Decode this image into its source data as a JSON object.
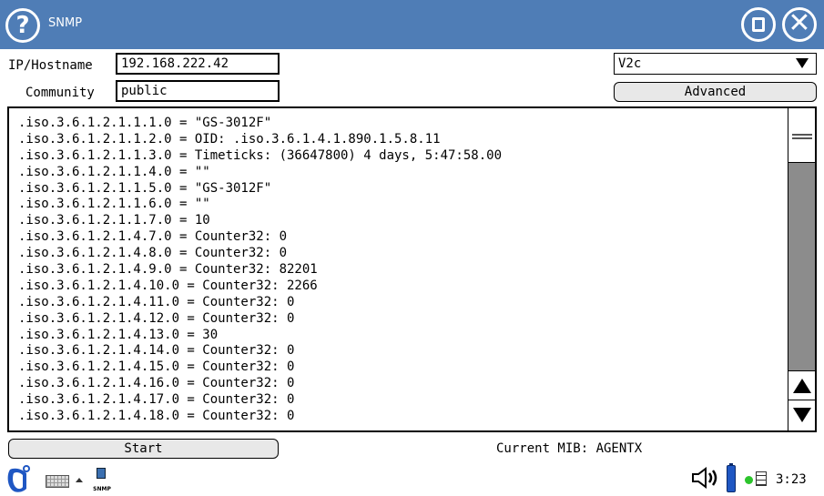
{
  "window": {
    "title": "SNMP",
    "help_glyph": "?",
    "close_glyph": "✕",
    "titlebar_color": "#4f7db6"
  },
  "form": {
    "ip_label": "IP/Hostname",
    "ip_value": "192.168.222.42",
    "community_label": "Community",
    "community_value": "public",
    "version_selected": "V2c",
    "advanced_label": "Advanced"
  },
  "output": {
    "lines": [
      ".iso.3.6.1.2.1.1.1.0 = \"GS-3012F\"",
      ".iso.3.6.1.2.1.1.2.0 = OID: .iso.3.6.1.4.1.890.1.5.8.11",
      ".iso.3.6.1.2.1.1.3.0 = Timeticks: (36647800) 4 days, 5:47:58.00",
      ".iso.3.6.1.2.1.1.4.0 = \"\"",
      ".iso.3.6.1.2.1.1.5.0 = \"GS-3012F\"",
      ".iso.3.6.1.2.1.1.6.0 = \"\"",
      ".iso.3.6.1.2.1.1.7.0 = 10",
      ".iso.3.6.1.2.1.4.7.0 = Counter32: 0",
      ".iso.3.6.1.2.1.4.8.0 = Counter32: 0",
      ".iso.3.6.1.2.1.4.9.0 = Counter32: 82201",
      ".iso.3.6.1.2.1.4.10.0 = Counter32: 2266",
      ".iso.3.6.1.2.1.4.11.0 = Counter32: 0",
      ".iso.3.6.1.2.1.4.12.0 = Counter32: 0",
      ".iso.3.6.1.2.1.4.13.0 = 30",
      ".iso.3.6.1.2.1.4.14.0 = Counter32: 0",
      ".iso.3.6.1.2.1.4.15.0 = Counter32: 0",
      ".iso.3.6.1.2.1.4.16.0 = Counter32: 0",
      ".iso.3.6.1.2.1.4.17.0 = Counter32: 0",
      ".iso.3.6.1.2.1.4.18.0 = Counter32: 0"
    ]
  },
  "controls": {
    "start_label": "Start",
    "mib_status": "Current MIB: AGENTX"
  },
  "taskbar": {
    "task_label": "SNMP",
    "clock": "3:23",
    "battery_color": "#1f57c3",
    "network_status_color": "#2cc42c"
  }
}
